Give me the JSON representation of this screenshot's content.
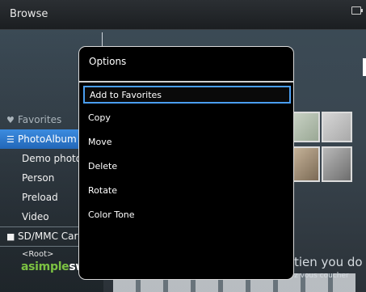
{
  "header": {
    "title": "Browse"
  },
  "sidebar": {
    "favorites": "Favorites",
    "photo_album": "PhotoAlbum",
    "sub_items": [
      "Demo photos",
      "Person",
      "Preload",
      "Video"
    ],
    "card": "SD/MMC Card",
    "root": "<Root>"
  },
  "logo": {
    "part1": "asimple",
    "part2": "sw"
  },
  "promo": {
    "line1": "tien you do",
    "line2": "z vous coucher"
  },
  "dialog": {
    "title": "Options",
    "items": [
      "Add to Favorites",
      "Copy",
      "Move",
      "Delete",
      "Rotate",
      "Color Tone"
    ],
    "selected_index": 0
  },
  "colors": {
    "highlight": "#2f7fd6",
    "selection_border": "#4a9ef0"
  }
}
